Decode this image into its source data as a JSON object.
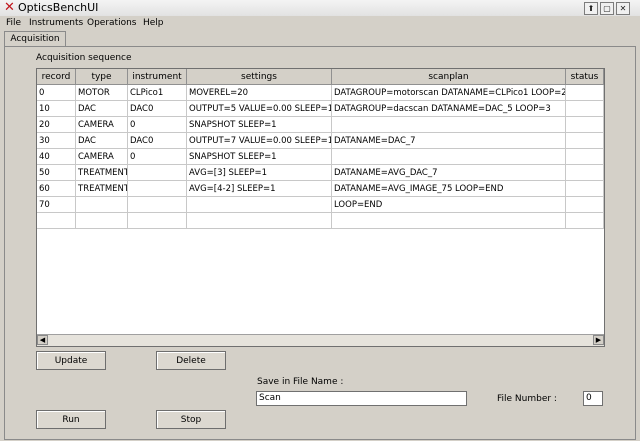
{
  "window": {
    "title": "OpticsBenchUI"
  },
  "menu": [
    "File",
    "Instruments",
    "Operations",
    "Help"
  ],
  "tabs": [
    {
      "label": "Acquisition"
    }
  ],
  "sequence": {
    "label": "Acquisition sequence",
    "columns": [
      "record",
      "type",
      "instrument",
      "settings",
      "scanplan",
      "status"
    ],
    "rows": [
      [
        "0",
        "MOTOR",
        "CLPico1",
        "MOVEREL=20",
        "DATAGROUP=motorscan  DATANAME=CLPico1 LOOP=2",
        ""
      ],
      [
        "10",
        "DAC",
        "DAC0",
        "OUTPUT=5 VALUE=0.00 SLEEP=1",
        "DATAGROUP=dacscan DATANAME=DAC_5  LOOP=3",
        ""
      ],
      [
        "20",
        "CAMERA",
        "0",
        "SNAPSHOT SLEEP=1",
        "",
        ""
      ],
      [
        "30",
        "DAC",
        "DAC0",
        "OUTPUT=7 VALUE=0.00 SLEEP=1",
        "DATANAME=DAC_7",
        ""
      ],
      [
        "40",
        "CAMERA",
        "0",
        "SNAPSHOT SLEEP=1",
        "",
        ""
      ],
      [
        "50",
        "TREATMENT",
        "",
        "AVG=[3] SLEEP=1",
        "DATANAME=AVG_DAC_7",
        ""
      ],
      [
        "60",
        "TREATMENT",
        "",
        "AVG=[4-2] SLEEP=1",
        "DATANAME=AVG_IMAGE_75 LOOP=END",
        ""
      ],
      [
        "70",
        "",
        "",
        "",
        "LOOP=END",
        ""
      ],
      [
        "",
        "",
        "",
        "",
        "",
        ""
      ]
    ]
  },
  "buttons": {
    "update": "Update",
    "delete": "Delete",
    "run": "Run",
    "stop": "Stop"
  },
  "save": {
    "label": "Save in File Name :",
    "value": "Scan"
  },
  "file_number": {
    "label": "File Number :",
    "value": "0"
  }
}
